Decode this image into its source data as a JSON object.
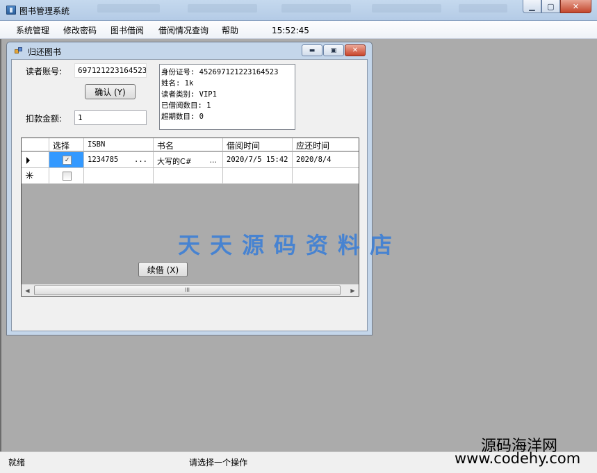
{
  "app": {
    "title": "图书管理系统"
  },
  "menu": {
    "items": [
      "系统管理",
      "修改密码",
      "图书借阅",
      "借阅情况查询",
      "帮助"
    ],
    "clock": "15:52:45"
  },
  "dialog": {
    "title": "归还图书",
    "reader_label": "读者账号:",
    "reader_value": "697121223164523",
    "confirm_label": "确认 (Y)",
    "deduct_label": "扣款金额:",
    "deduct_value": "1",
    "info_lines": [
      "身份证号: 452697121223164523",
      "姓名: 1k",
      "读者类别: VIP1",
      "已借阅数目: 1",
      "超期数目: 0"
    ],
    "renew_label": "续借 (X)"
  },
  "grid": {
    "headers": [
      "选择",
      "ISBN",
      "书名",
      "借阅时间",
      "应还时间"
    ],
    "rows": [
      {
        "checked": true,
        "isbn": "1234785",
        "title": "大写的C#",
        "borrow": "2020/7/5 15:42",
        "due": "2020/8/4"
      }
    ],
    "ellipsis": "..."
  },
  "watermark": "天天源码资料店",
  "status": {
    "left": "就绪",
    "center": "请选择一个操作"
  },
  "corner_watermark": {
    "line1": "源码海洋网",
    "line2": "www.codehy.com"
  }
}
